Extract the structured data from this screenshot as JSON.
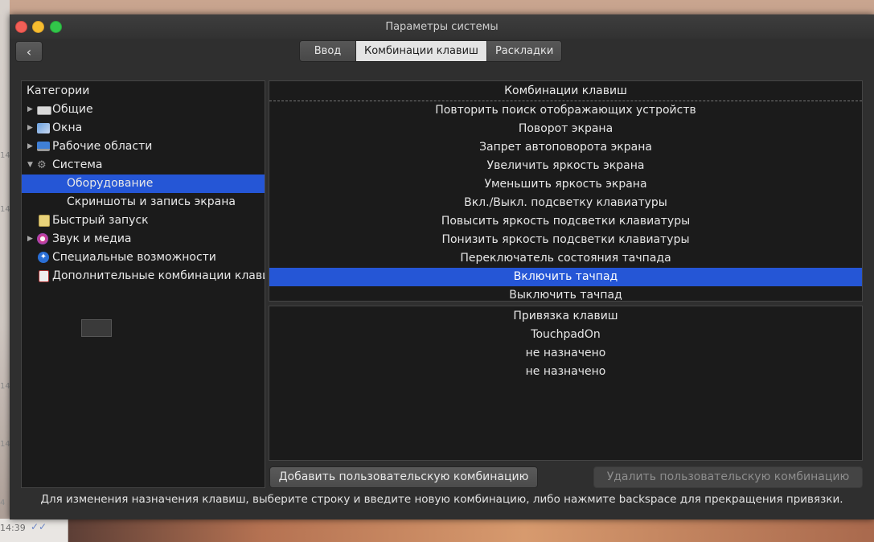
{
  "window": {
    "title": "Параметры системы"
  },
  "tabs": [
    {
      "label": "Ввод"
    },
    {
      "label": "Комбинации клавиш"
    },
    {
      "label": "Раскладки"
    }
  ],
  "categories": {
    "header": "Категории",
    "items": [
      {
        "label": "Общие",
        "icon": "keyboard-icon",
        "arrow": "right"
      },
      {
        "label": "Окна",
        "icon": "windows-icon",
        "arrow": "right"
      },
      {
        "label": "Рабочие области",
        "icon": "monitor-icon",
        "arrow": "right"
      },
      {
        "label": "Система",
        "icon": "gears-icon",
        "arrow": "down"
      },
      {
        "label": "Оборудование",
        "sub": true,
        "selected": true
      },
      {
        "label": "Скриншоты и запись экрана",
        "sub": true
      },
      {
        "label": "Быстрый запуск",
        "icon": "pencil-note-icon"
      },
      {
        "label": "Звук и медиа",
        "icon": "music-icon",
        "arrow": "right"
      },
      {
        "label": "Специальные возможности",
        "icon": "accessibility-icon"
      },
      {
        "label": "Дополнительные комбинации клави",
        "icon": "custom-shortcut-icon"
      }
    ]
  },
  "shortcuts": {
    "header": "Комбинации клавиш",
    "items": [
      "Повторить поиск отображающих устройств",
      "Поворот экрана",
      "Запрет автоповорота экрана",
      "Увеличить яркость экрана",
      "Уменьшить яркость экрана",
      "Вкл./Выкл. подсветку клавиатуры",
      "Повысить яркость подсветки клавиатуры",
      "Понизить яркость подсветки клавиатуры",
      "Переключатель состояния тачпада",
      "Включить тачпад",
      "Выключить тачпад"
    ],
    "selected_index": 9
  },
  "binding": {
    "header": "Привязка клавиш",
    "items": [
      "TouchpadOn",
      "не назначено",
      "не назначено"
    ]
  },
  "buttons": {
    "add": "Добавить пользовательскую комбинацию",
    "remove": "Удалить пользовательскую комбинацию"
  },
  "hint": "Для изменения назначения клавиш, выберите строку и введите новую комбинацию, либо нажмите backspace для прекращения привязки.",
  "background": {
    "time": "14:39",
    "fragments": [
      "14",
      "14",
      "14",
      "14",
      "4"
    ]
  }
}
